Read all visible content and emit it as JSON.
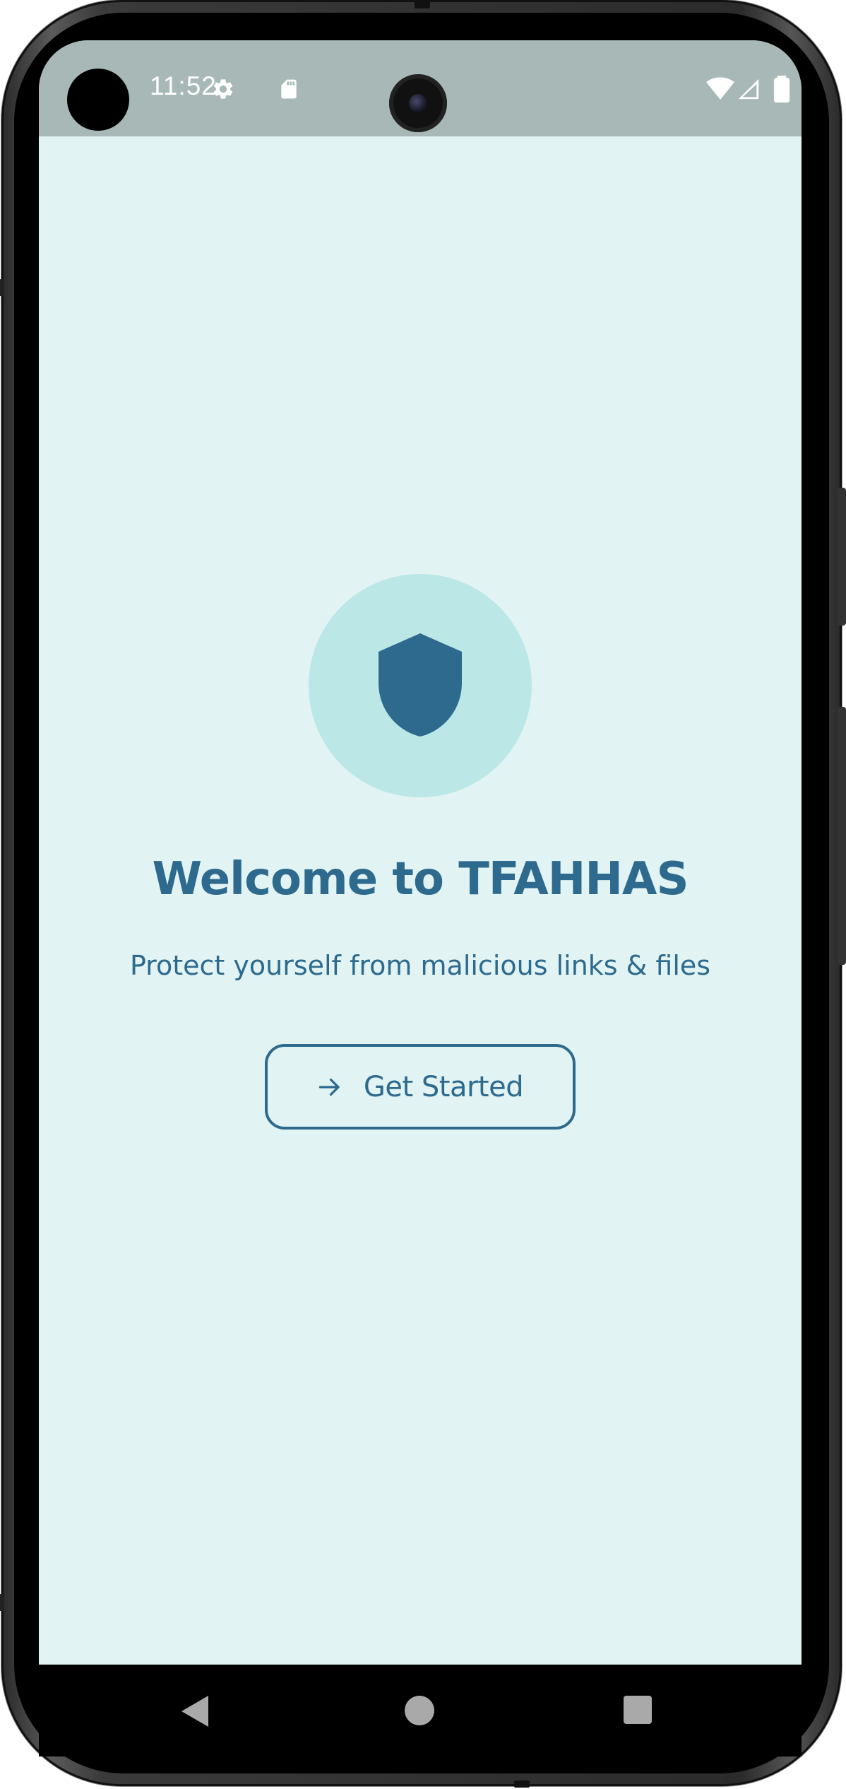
{
  "status_bar": {
    "time": "11:52",
    "icons": [
      "gear-icon",
      "sd-card-icon",
      "wifi-icon",
      "signal-icon",
      "battery-icon"
    ]
  },
  "welcome": {
    "icon": "shield-icon",
    "title": "Welcome to TFAHHAS",
    "subtitle": "Protect yourself from malicious links & files",
    "button_label": "Get Started",
    "button_icon": "arrow-right-icon"
  },
  "nav_bar": {
    "icons": [
      "back-icon",
      "home-icon",
      "recents-icon"
    ]
  },
  "colors": {
    "background": "#e1f3f2",
    "status_bar": "#a8b8b6",
    "accent": "#2d6a8e",
    "icon_circle": "#bbe7e7"
  }
}
